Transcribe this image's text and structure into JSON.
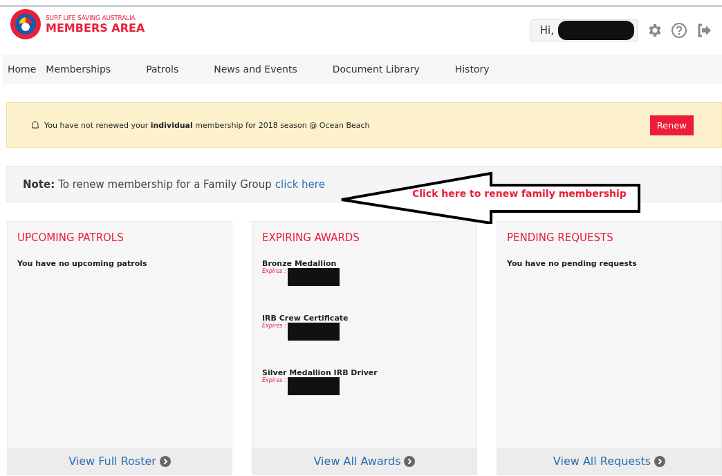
{
  "header": {
    "brand_small": "SURF LIFE SAVING AUSTRALIA",
    "brand_large": "MEMBERS AREA",
    "greeting": "Hi,"
  },
  "nav": [
    {
      "label": "Home"
    },
    {
      "label": "Memberships"
    },
    {
      "label": "Patrols"
    },
    {
      "label": "News and Events"
    },
    {
      "label": "Document Library"
    },
    {
      "label": "History"
    }
  ],
  "alert": {
    "text": "You have not renewed your **individual** membership for 2018 season @ Ocean Beach",
    "button": "Renew"
  },
  "note": {
    "label": "Note:",
    "text": "To renew membership for a Family Group",
    "link": "click here"
  },
  "callout": {
    "text": "Click here to renew family membership"
  },
  "cards": [
    {
      "title": "UPCOMING PATROLS",
      "empty": "You have no upcoming patrols",
      "footer": "View Full Roster"
    },
    {
      "title": "EXPIRING AWARDS",
      "items": [
        {
          "name": "Bronze Medallion",
          "expires": "Expires :"
        },
        {
          "name": "IRB Crew Certificate",
          "expires": "Expires :"
        },
        {
          "name": "Silver Medallion IRB Driver",
          "expires": "Expires :"
        }
      ],
      "footer": "View All Awards"
    },
    {
      "title": "PENDING REQUESTS",
      "empty": "You have no pending requests",
      "footer": "View All Requests"
    }
  ]
}
